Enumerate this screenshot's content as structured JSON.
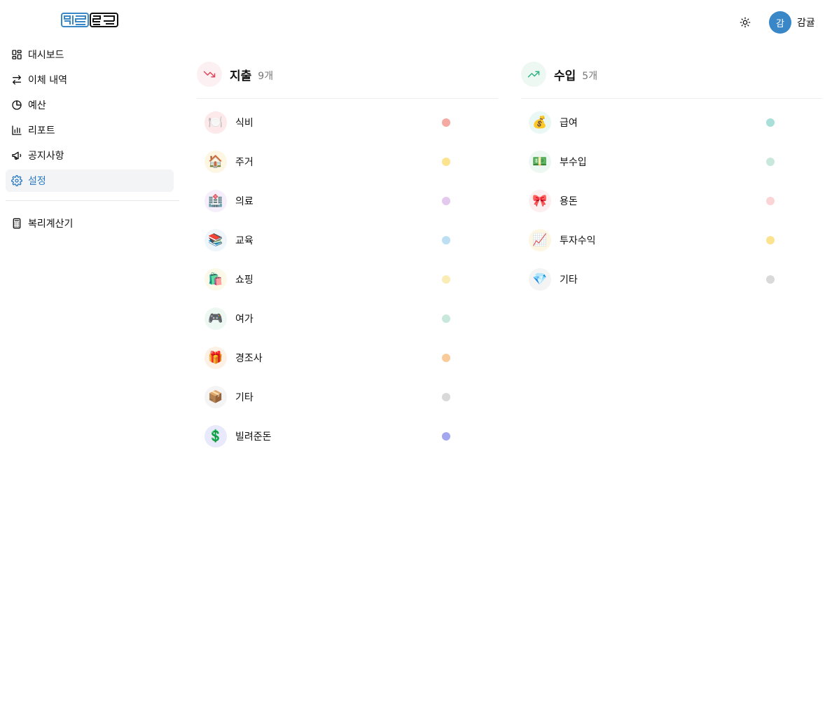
{
  "header": {
    "logo_text": "하루가계",
    "user_initial": "감",
    "user_name": "감귤"
  },
  "sidebar": {
    "items": [
      {
        "label": "대시보드",
        "icon": "dashboard-icon"
      },
      {
        "label": "이체 내역",
        "icon": "arrows-swap-icon"
      },
      {
        "label": "예산",
        "icon": "pie-chart-icon"
      },
      {
        "label": "리포트",
        "icon": "bar-chart-icon"
      },
      {
        "label": "공지사항",
        "icon": "megaphone-icon"
      },
      {
        "label": "설정",
        "icon": "gear-icon",
        "active": true
      }
    ],
    "tools": [
      {
        "label": "복리계산기",
        "icon": "calculator-icon"
      }
    ]
  },
  "expense": {
    "title": "지출",
    "count": "9개",
    "accent": "#e0455b",
    "items": [
      {
        "emoji": "🍽️",
        "name": "식비",
        "bg": "#fde8ea",
        "color": "#f4a9a1"
      },
      {
        "emoji": "🏠",
        "name": "주거",
        "bg": "#fdf6e3",
        "color": "#fbe38f"
      },
      {
        "emoji": "🏥",
        "name": "의료",
        "bg": "#f6eefa",
        "color": "#e3c9ee"
      },
      {
        "emoji": "📚",
        "name": "교육",
        "bg": "#eef6fb",
        "color": "#bcdff3"
      },
      {
        "emoji": "🛍️",
        "name": "쇼핑",
        "bg": "#fdf9e8",
        "color": "#f9ecb5"
      },
      {
        "emoji": "🎮",
        "name": "여가",
        "bg": "#eef8f3",
        "color": "#c8e8dc"
      },
      {
        "emoji": "🎁",
        "name": "경조사",
        "bg": "#fdf1e6",
        "color": "#f9cb9a"
      },
      {
        "emoji": "📦",
        "name": "기타",
        "bg": "#f4f4f5",
        "color": "#d9d9d9"
      },
      {
        "emoji": "💲",
        "name": "빌려준돈",
        "bg": "#e8e9fb",
        "color": "#a3a7ef"
      }
    ]
  },
  "income": {
    "title": "수입",
    "count": "5개",
    "accent": "#2fb380",
    "items": [
      {
        "emoji": "💰",
        "name": "급여",
        "bg": "#e9f7f5",
        "color": "#a8dfd9"
      },
      {
        "emoji": "💵",
        "name": "부수입",
        "bg": "#eef8f3",
        "color": "#c8e8dc"
      },
      {
        "emoji": "🎀",
        "name": "용돈",
        "bg": "#fdeff0",
        "color": "#fbd4d6"
      },
      {
        "emoji": "📈",
        "name": "투자수익",
        "bg": "#fdf6e3",
        "color": "#fbe38f"
      },
      {
        "emoji": "💎",
        "name": "기타",
        "bg": "#f4f4f5",
        "color": "#d9d9d9"
      }
    ]
  }
}
